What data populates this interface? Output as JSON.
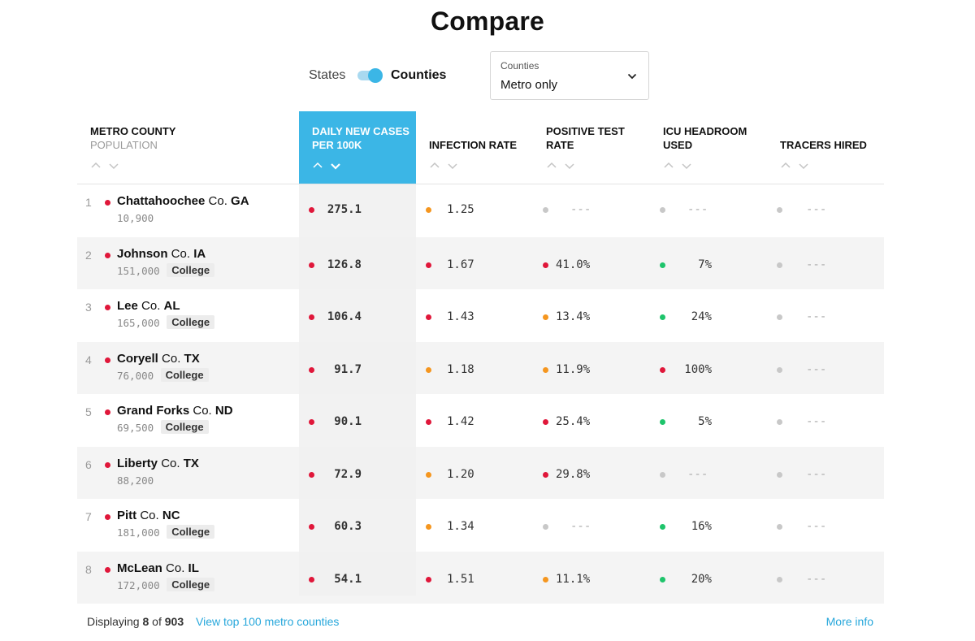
{
  "title": "Compare",
  "controls": {
    "toggle_left": "States",
    "toggle_right": "Counties",
    "dropdown_label": "Counties",
    "dropdown_value": "Metro only"
  },
  "columns": [
    {
      "label": "METRO COUNTY",
      "sub": "POPULATION"
    },
    {
      "label": "DAILY NEW CASES PER 100K",
      "sub": ""
    },
    {
      "label": "INFECTION RATE",
      "sub": ""
    },
    {
      "label": "POSITIVE TEST RATE",
      "sub": ""
    },
    {
      "label": "ICU HEADROOM USED",
      "sub": ""
    },
    {
      "label": "TRACERS HIRED",
      "sub": ""
    }
  ],
  "status_colors": {
    "red": "#e0173a",
    "orange": "#f5961f",
    "green": "#1ec46b",
    "gray": "#c8c8c8"
  },
  "accent_color": "#3bb6e6",
  "rows": [
    {
      "rank": "1",
      "name": "Chattahoochee",
      "co": "Co.",
      "state": "GA",
      "population": "10,900",
      "tag": "",
      "cases": "275.1",
      "cases_c": "red",
      "infection": "1.25",
      "infection_c": "orange",
      "positive": "---",
      "positive_c": "gray",
      "icu": "---",
      "icu_c": "gray",
      "tracers": "---",
      "tracers_c": "gray"
    },
    {
      "rank": "2",
      "name": "Johnson",
      "co": "Co.",
      "state": "IA",
      "population": "151,000",
      "tag": "College",
      "cases": "126.8",
      "cases_c": "red",
      "infection": "1.67",
      "infection_c": "red",
      "positive": "41.0%",
      "positive_c": "red",
      "icu": "7%",
      "icu_c": "green",
      "tracers": "---",
      "tracers_c": "gray"
    },
    {
      "rank": "3",
      "name": "Lee",
      "co": "Co.",
      "state": "AL",
      "population": "165,000",
      "tag": "College",
      "cases": "106.4",
      "cases_c": "red",
      "infection": "1.43",
      "infection_c": "red",
      "positive": "13.4%",
      "positive_c": "orange",
      "icu": "24%",
      "icu_c": "green",
      "tracers": "---",
      "tracers_c": "gray"
    },
    {
      "rank": "4",
      "name": "Coryell",
      "co": "Co.",
      "state": "TX",
      "population": "76,000",
      "tag": "College",
      "cases": "91.7",
      "cases_c": "red",
      "infection": "1.18",
      "infection_c": "orange",
      "positive": "11.9%",
      "positive_c": "orange",
      "icu": "100%",
      "icu_c": "red",
      "tracers": "---",
      "tracers_c": "gray"
    },
    {
      "rank": "5",
      "name": "Grand Forks",
      "co": "Co.",
      "state": "ND",
      "population": "69,500",
      "tag": "College",
      "cases": "90.1",
      "cases_c": "red",
      "infection": "1.42",
      "infection_c": "red",
      "positive": "25.4%",
      "positive_c": "red",
      "icu": "5%",
      "icu_c": "green",
      "tracers": "---",
      "tracers_c": "gray"
    },
    {
      "rank": "6",
      "name": "Liberty",
      "co": "Co.",
      "state": "TX",
      "population": "88,200",
      "tag": "",
      "cases": "72.9",
      "cases_c": "red",
      "infection": "1.20",
      "infection_c": "orange",
      "positive": "29.8%",
      "positive_c": "red",
      "icu": "---",
      "icu_c": "gray",
      "tracers": "---",
      "tracers_c": "gray"
    },
    {
      "rank": "7",
      "name": "Pitt",
      "co": "Co.",
      "state": "NC",
      "population": "181,000",
      "tag": "College",
      "cases": "60.3",
      "cases_c": "red",
      "infection": "1.34",
      "infection_c": "orange",
      "positive": "---",
      "positive_c": "gray",
      "icu": "16%",
      "icu_c": "green",
      "tracers": "---",
      "tracers_c": "gray"
    },
    {
      "rank": "8",
      "name": "McLean",
      "co": "Co.",
      "state": "IL",
      "population": "172,000",
      "tag": "College",
      "cases": "54.1",
      "cases_c": "red",
      "infection": "1.51",
      "infection_c": "red",
      "positive": "11.1%",
      "positive_c": "orange",
      "icu": "20%",
      "icu_c": "green",
      "tracers": "---",
      "tracers_c": "gray"
    }
  ],
  "footer": {
    "displaying": "Displaying",
    "shown": "8",
    "of": "of",
    "total": "903",
    "view_link": "View top 100 metro counties",
    "more_info": "More info"
  }
}
